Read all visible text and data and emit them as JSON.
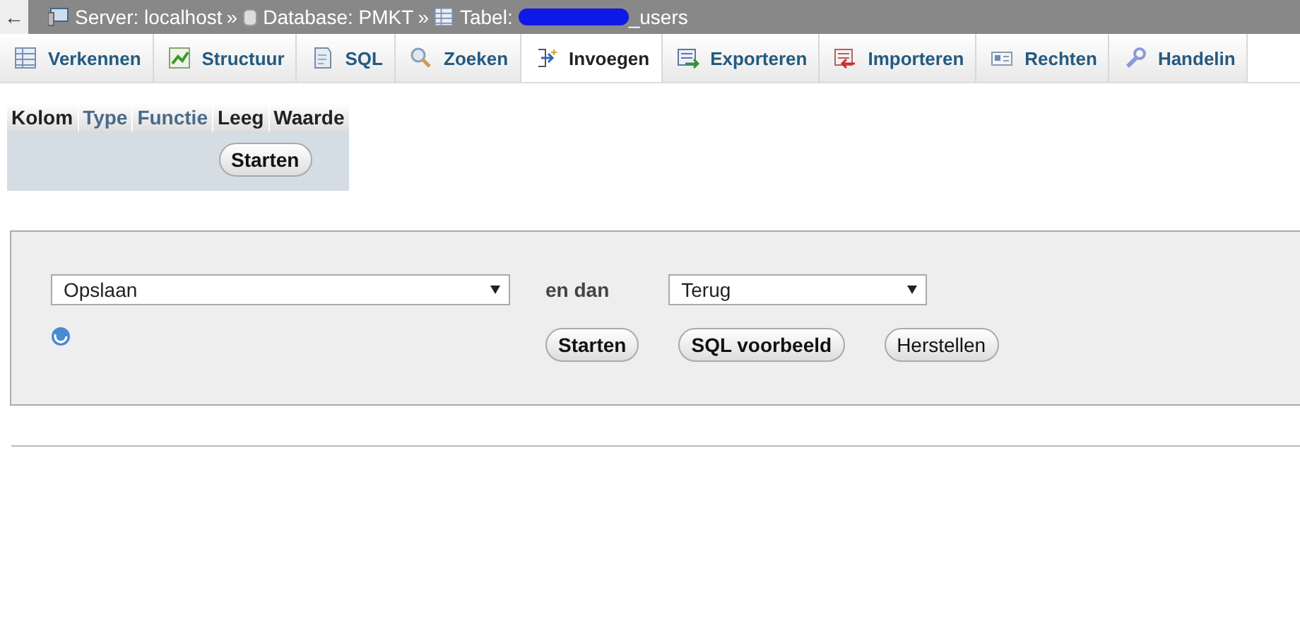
{
  "breadcrumb": {
    "back": "←",
    "server": "Server: localhost",
    "sep1": "»",
    "database": "Database: PMKT",
    "sep2": "»",
    "table_label": "Tabel:",
    "table_name": "_users"
  },
  "tabs": [
    {
      "label": "Verkennen",
      "selected": false
    },
    {
      "label": "Structuur",
      "selected": false
    },
    {
      "label": "SQL",
      "selected": false
    },
    {
      "label": "Zoeken",
      "selected": false
    },
    {
      "label": "Invoegen",
      "selected": true
    },
    {
      "label": "Exporteren",
      "selected": false
    },
    {
      "label": "Importeren",
      "selected": false
    },
    {
      "label": "Rechten",
      "selected": false
    },
    {
      "label": "Handelin",
      "selected": false
    }
  ],
  "insert_table": {
    "columns": [
      {
        "label": "Kolom",
        "link": false
      },
      {
        "label": "Type",
        "link": true
      },
      {
        "label": "Functie",
        "link": true
      },
      {
        "label": "Leeg",
        "link": false
      },
      {
        "label": "Waarde",
        "link": false
      }
    ],
    "button": "Starten"
  },
  "form": {
    "action": "Opslaan",
    "then_label": "en dan",
    "after": "Terug",
    "buttons": [
      "Starten",
      "SQL voorbeeld",
      "Herstellen"
    ]
  }
}
